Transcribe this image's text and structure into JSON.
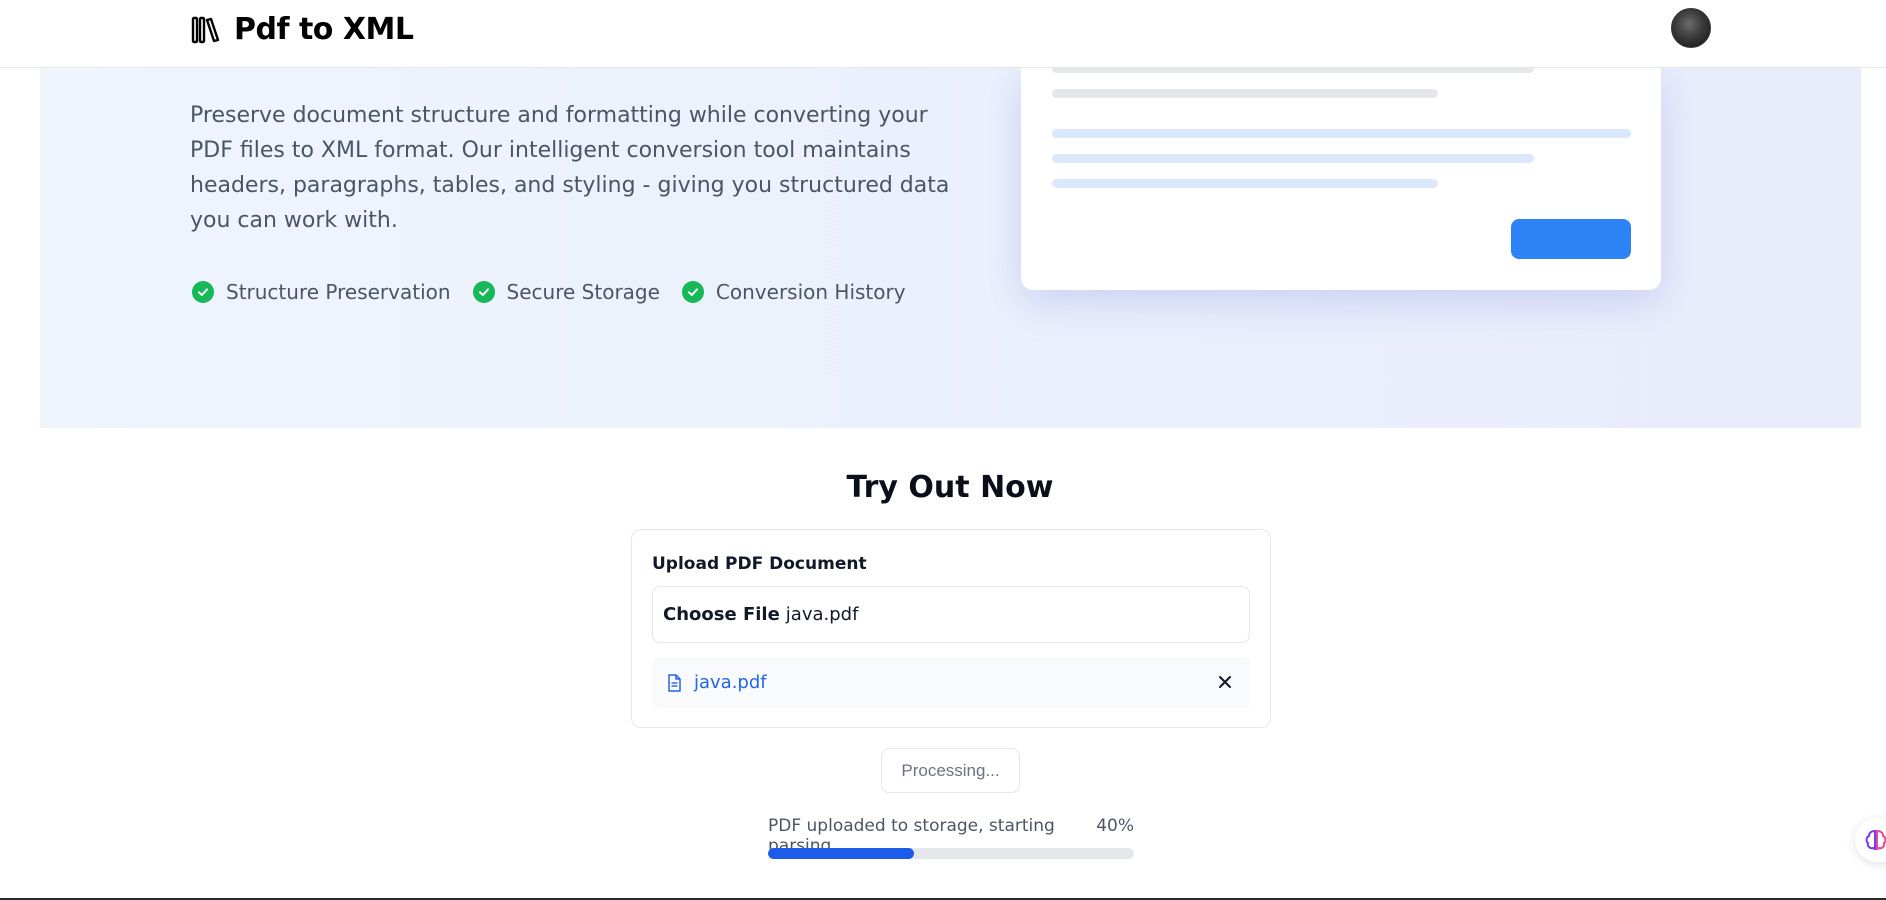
{
  "app": {
    "title": "Pdf to XML"
  },
  "hero": {
    "description": "Preserve document structure and formatting while converting your PDF files to XML format. Our intelligent conversion tool maintains headers, paragraphs, tables, and styling - giving you structured data you can work with.",
    "features": [
      "Structure Preservation",
      "Secure Storage",
      "Conversion History"
    ]
  },
  "try_section": {
    "title": "Try Out Now",
    "upload_label": "Upload PDF Document",
    "choose_file_label": "Choose File",
    "chosen_file": "java.pdf",
    "file_item_name": "java.pdf",
    "processing_label": "Processing...",
    "status_text": "PDF uploaded to storage, starting parsing",
    "progress_percent_label": "40%",
    "progress_fraction": 0.4
  },
  "icons": {
    "brand": "books-icon",
    "feature_check": "check-circle-icon",
    "file": "document-icon",
    "remove": "close-icon",
    "floating": "brain-icon"
  },
  "colors": {
    "accent": "#2d83f5",
    "progress": "#1d5ce8",
    "success": "#16b857",
    "link": "#2563eb"
  }
}
